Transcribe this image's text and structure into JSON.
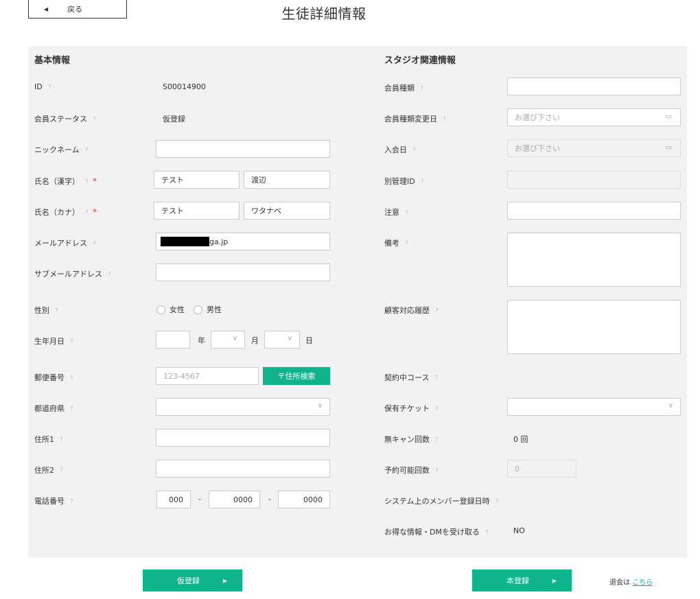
{
  "header": {
    "back_label": "戻る",
    "back_icon": "triangle-left-icon",
    "title": "生徒詳細情報"
  },
  "help_glyph": "?",
  "basic": {
    "section_title": "基本情報",
    "id_label": "ID",
    "id_value": "S00014900",
    "status_label": "会員ステータス",
    "status_value": "仮登録",
    "nickname_label": "ニックネーム",
    "nickname_value": "",
    "name_kanji_label": "氏名（漢字）",
    "name_kanji_last": "テスト",
    "name_kanji_first": "渡辺",
    "name_kana_label": "氏名（カナ）",
    "name_kana_last": "テスト",
    "name_kana_first": "ワタナベ",
    "required_mark": "*",
    "email_label": "メールアドレス",
    "email_visible_suffix": "ga.jp",
    "sub_email_label": "サブメールアドレス",
    "sub_email_value": "",
    "gender_label": "性別",
    "gender_female": "女性",
    "gender_male": "男性",
    "birth_label": "生年月日",
    "birth_year_unit": "年",
    "birth_month_unit": "月",
    "birth_day_unit": "日",
    "postal_label": "郵便番号",
    "postal_placeholder": "123-4567",
    "address_search_label": "〒住所検索",
    "prefecture_label": "都道府県",
    "address1_label": "住所1",
    "address2_label": "住所2",
    "phone_label": "電話番号",
    "phone_1": "000",
    "phone_2": "0000",
    "phone_3": "0000",
    "phone_sep": "-"
  },
  "studio": {
    "section_title": "スタジオ関連情報",
    "member_type_label": "会員種類",
    "member_type_change_label": "会員種類変更日",
    "date_placeholder": "お選び下さい",
    "join_date_label": "入会日",
    "alt_id_label": "別管理ID",
    "caution_label": "注意",
    "notes_label": "備考",
    "history_label": "顧客対応履歴",
    "course_label": "契約中コース",
    "ticket_label": "保有チケット",
    "nocancel_label": "無キャン回数",
    "nocancel_value": "0 回",
    "reservable_label": "予約可能回数",
    "reservable_value": "0",
    "system_reg_label": "システム上のメンバー登録日時",
    "dm_label": "お得な情報・DMを受け取る",
    "dm_value": "NO"
  },
  "footer": {
    "provisional_button": "仮登録",
    "register_button": "本登録",
    "withdraw_text": "退会は",
    "withdraw_link": "こちら"
  }
}
